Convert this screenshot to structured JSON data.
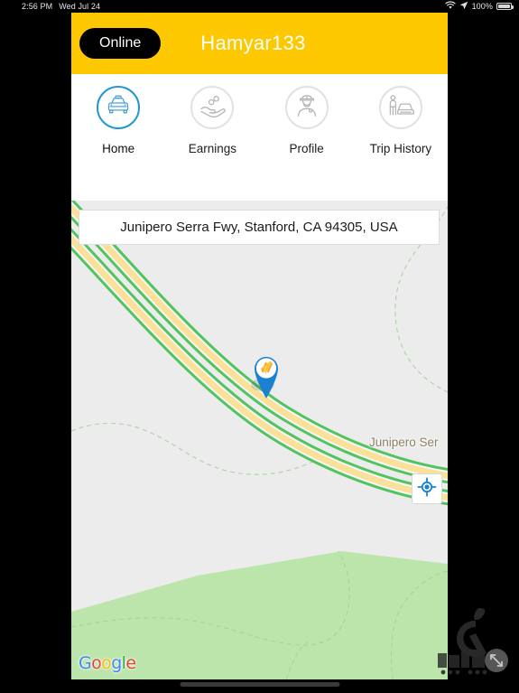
{
  "status_bar": {
    "time": "2:56 PM",
    "date": "Wed Jul 24",
    "battery_percent": "100%",
    "wifi_icon": "wifi-icon",
    "location_icon": "location-arrow-icon",
    "battery_icon": "battery-full-icon"
  },
  "header": {
    "status_button_label": "Online",
    "title": "Hamyar133",
    "background_color": "#fdc800",
    "status_button_bg": "#000000",
    "title_color": "#ffffff"
  },
  "nav": {
    "items": [
      {
        "label": "Home",
        "icon": "taxi-icon",
        "active": true
      },
      {
        "label": "Earnings",
        "icon": "hand-coins-icon",
        "active": false
      },
      {
        "label": "Profile",
        "icon": "driver-cap-icon",
        "active": false
      },
      {
        "label": "Trip History",
        "icon": "person-car-icon",
        "active": false
      }
    ],
    "active_color": "#2196d6",
    "inactive_color": "#c9c9c9"
  },
  "map": {
    "address": "Junipero Serra Fwy, Stanford, CA 94305, USA",
    "road_label": "Junipero Ser",
    "my_location_button_icon": "crosshair-target-icon",
    "marker_icon": "app-logo-pin-icon",
    "attribution": "Google",
    "attribution_letters": [
      "G",
      "o",
      "o",
      "g",
      "l",
      "e"
    ],
    "background_color": "#ececec",
    "park_color": "#b8e3a8",
    "highway_color": "#fbe09a",
    "traffic_color": "#51c460",
    "marker_color": "#1a82d0"
  },
  "overlay": {
    "store_watermark": "sibche-logo-watermark",
    "resize_handle": "resize-arrows-icon",
    "home_indicator": "home-indicator-bar"
  }
}
